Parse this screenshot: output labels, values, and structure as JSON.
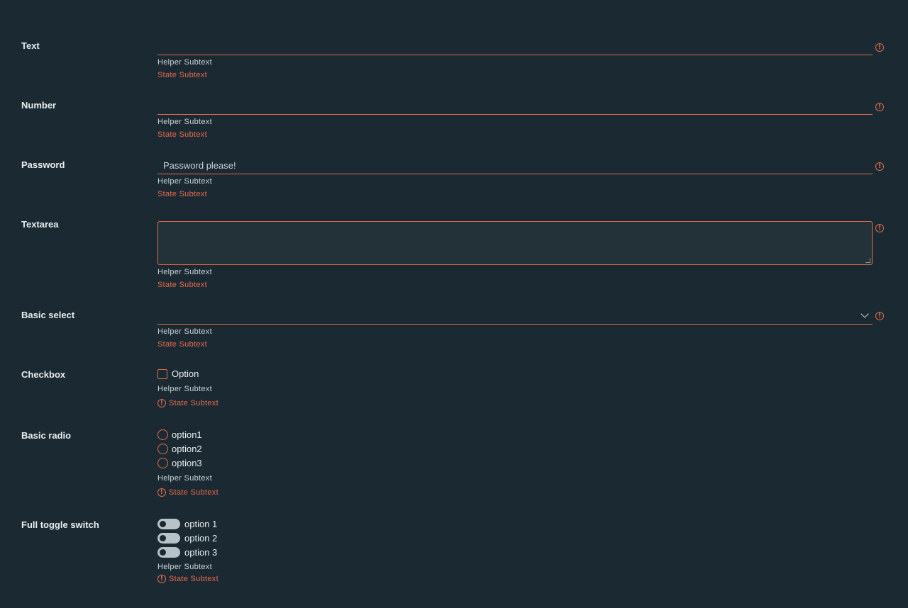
{
  "colors": {
    "background": "#1b2a32",
    "error": "#e46a4a",
    "text": "#e8edee",
    "muted": "#c9d3d6"
  },
  "helper_text": "Helper Subtext",
  "state_text": "State Subtext",
  "fields": {
    "text": {
      "label": "Text"
    },
    "number": {
      "label": "Number"
    },
    "password": {
      "label": "Password",
      "placeholder": "Password please!"
    },
    "textarea": {
      "label": "Textarea"
    },
    "select": {
      "label": "Basic select",
      "value": ""
    },
    "checkbox": {
      "label": "Checkbox",
      "option": "Option"
    },
    "radio": {
      "label": "Basic radio",
      "options": [
        "option1",
        "option2",
        "option3"
      ]
    },
    "toggle": {
      "label": "Full toggle switch",
      "options": [
        "option 1",
        "option 2",
        "option 3"
      ]
    }
  }
}
